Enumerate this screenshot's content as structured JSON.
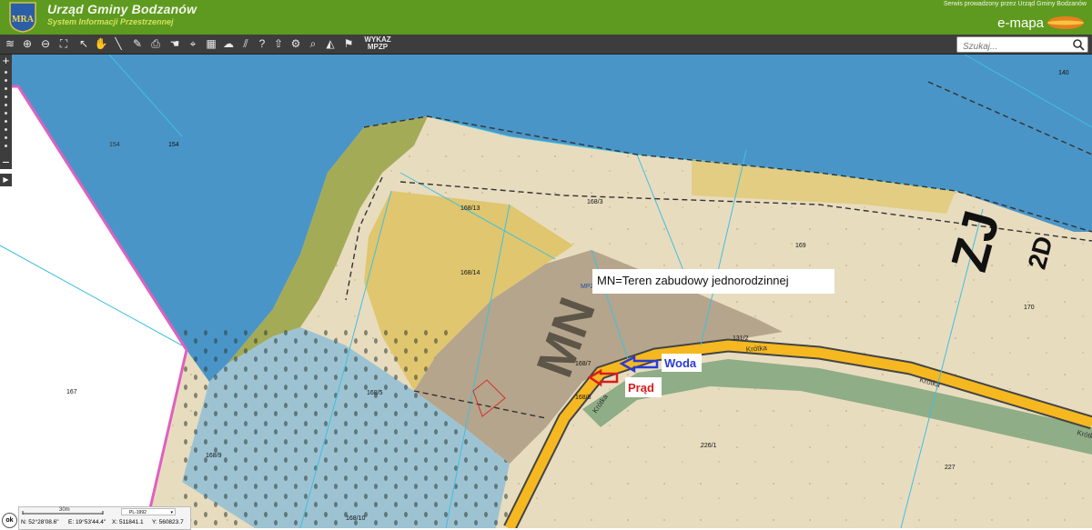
{
  "header": {
    "title": "Urząd Gminy Bodzanów",
    "subtitle": "System Informacji Przestrzennej",
    "service_text": "Serwis prowadzony przez Urząd Gminy Bodzanów",
    "brand": "e-mapa",
    "logo_text": "MRA",
    "accent_color": "#5e9a1f"
  },
  "toolbar": {
    "tools": [
      "layers-icon",
      "zoom-in-icon",
      "zoom-out-icon",
      "full-extent-icon",
      "select-icon",
      "pan-icon",
      "measure-distance-icon",
      "measure-area-icon",
      "print-icon",
      "hand-icon",
      "pin-icon",
      "layout-icon",
      "chat-icon",
      "hatch-icon",
      "help-icon",
      "upload-icon",
      "settings-icon",
      "find-icon",
      "triangle-icon",
      "share-icon"
    ],
    "list_button_line1": "WYKAZ",
    "list_button_line2": "MPZP"
  },
  "search": {
    "placeholder": "Szukaj..."
  },
  "map": {
    "parcels": [
      "140",
      "154",
      "154",
      "167",
      "169",
      "170",
      "131/2",
      "168/3",
      "168/13",
      "168/14",
      "168/5",
      "168/7",
      "168/8",
      "168/9",
      "168/10",
      "226/1",
      "227"
    ],
    "street_name": "Krótka",
    "symbol_mn": "MN",
    "symbol_zj": "ZJ",
    "symbol_2d": "2D",
    "plan_label": "MPZ",
    "legend_text": "MN=Teren zabudowy jednorodzinnej",
    "annotation_water": "Woda",
    "annotation_power": "Prąd",
    "water_color": "#2a3bd6",
    "power_color": "#d91c1c"
  },
  "status": {
    "coord_system": "PL-1992",
    "scale_label": "30m",
    "lat": "N: 52°28'08.6\"",
    "lon": "E: 19°53'44.4\"",
    "x": "X: 511841.1",
    "y": "Y: 560823.7",
    "ok_label": "ok"
  }
}
